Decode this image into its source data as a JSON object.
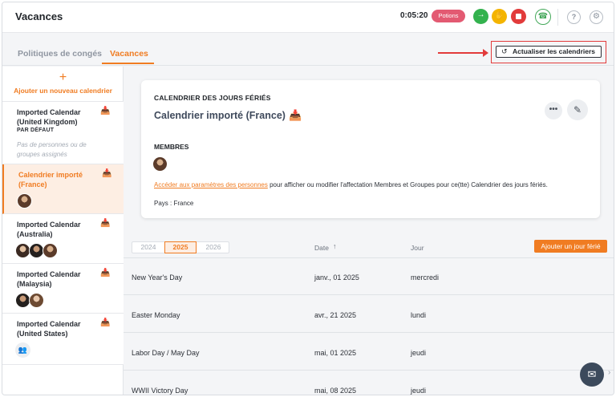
{
  "header": {
    "title": "Vacances",
    "timer": "0:05:20",
    "potions_label": "Potions"
  },
  "tabs": [
    {
      "label": "Politiques de congés",
      "active": false
    },
    {
      "label": "Vacances",
      "active": true
    }
  ],
  "toolbar": {
    "refresh_label": "Actualiser les calendriers"
  },
  "sidebar": {
    "add_label": "Ajouter un nouveau calendrier",
    "items": [
      {
        "name": "Imported Calendar (United Kingdom)",
        "default_label": "PAR DÉFAUT",
        "empty_text": "Pas de personnes ou de groupes assignés"
      },
      {
        "name": "Calendrier importé (France)",
        "active": true
      },
      {
        "name": "Imported Calendar (Australia)"
      },
      {
        "name": "Imported Calendar (Malaysia)"
      },
      {
        "name": "Imported Calendar (United States)"
      }
    ]
  },
  "card": {
    "kicker": "CALENDRIER DES JOURS FÉRIÉS",
    "title": "Calendrier importé (France)",
    "members_label": "MEMBRES",
    "link_text": "Accéder aux paramètres des personnes",
    "body_text": " pour afficher ou modifier l'affectation Membres et Groupes pour ce(tte) Calendrier des jours fériés.",
    "country_text": "Pays : France"
  },
  "table": {
    "years": [
      "2024",
      "2025",
      "2026"
    ],
    "selected_year": "2025",
    "col_date": "Date",
    "col_day": "Jour",
    "add_label": "Ajouter un jour férié",
    "rows": [
      {
        "name": "New Year's Day",
        "date": "janv., 01 2025",
        "day": "mercredi"
      },
      {
        "name": "Easter Monday",
        "date": "avr., 21 2025",
        "day": "lundi"
      },
      {
        "name": "Labor Day / May Day",
        "date": "mai, 01 2025",
        "day": "jeudi"
      },
      {
        "name": "WWII Victory Day",
        "date": "mai, 08 2025",
        "day": "jeudi"
      }
    ]
  },
  "colors": {
    "accent": "#f07c22",
    "potions_badge": "#e35a72",
    "annotation": "#e23b3b"
  }
}
